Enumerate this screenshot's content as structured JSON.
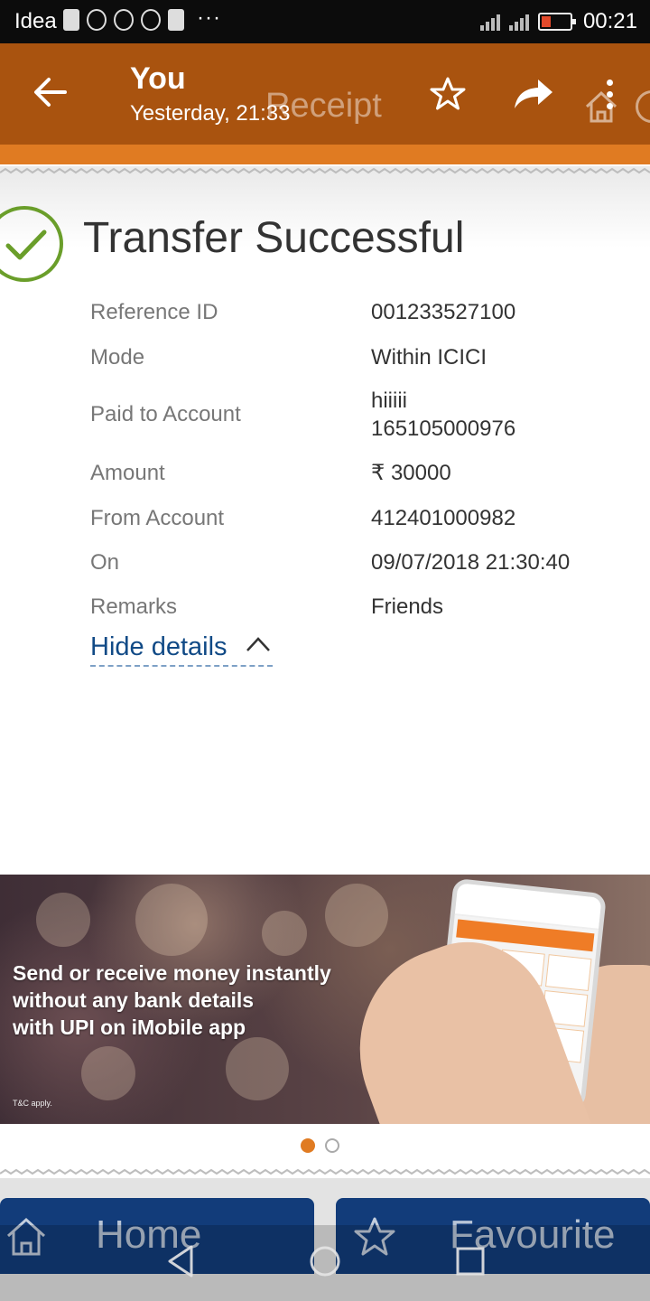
{
  "status_bar": {
    "carrier": "Idea",
    "more": "···",
    "time": "00:21"
  },
  "app_bar": {
    "title": "You",
    "subtitle": "Yesterday, 21:33",
    "screen_title": "Receipt"
  },
  "receipt": {
    "heading": "Transfer Successful",
    "rows": [
      {
        "label": "Reference ID",
        "value": "001233527100"
      },
      {
        "label": "Mode",
        "value": "Within ICICI"
      },
      {
        "label": "Paid to Account",
        "value": "hiiiii\n165105000976"
      },
      {
        "label": "Amount",
        "value": "₹ 30000"
      },
      {
        "label": "From Account",
        "value": "412401000982"
      },
      {
        "label": "On",
        "value": "09/07/2018 21:30:40"
      },
      {
        "label": "Remarks",
        "value": "Friends"
      }
    ],
    "hide_details_label": "Hide details"
  },
  "banner": {
    "line1": "Send or receive money instantly",
    "line2": "without any bank details",
    "line3": "with UPI on iMobile app",
    "tnc": "T&C apply.",
    "active_slide": 1,
    "slide_count": 2
  },
  "bottom_nav": {
    "home_label": "Home",
    "favourite_label": "Favourite"
  },
  "colors": {
    "app_bar": "#a9530f",
    "accent_orange": "#e07b22",
    "success_green": "#6a9e2a",
    "bottom_button": "#123c7a",
    "link": "#114a86"
  }
}
